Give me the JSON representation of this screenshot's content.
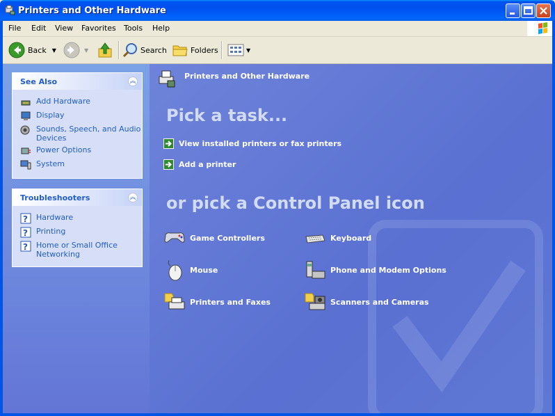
{
  "window": {
    "title": "Printers and Other Hardware"
  },
  "menu": [
    "File",
    "Edit",
    "View",
    "Favorites",
    "Tools",
    "Help"
  ],
  "toolbar": {
    "back_label": "Back",
    "search_label": "Search",
    "folders_label": "Folders"
  },
  "see_also": {
    "title": "See Also",
    "items": [
      {
        "label": "Add Hardware",
        "icon": "add-hardware-icon"
      },
      {
        "label": "Display",
        "icon": "display-icon"
      },
      {
        "label": "Sounds, Speech, and Audio Devices",
        "icon": "sounds-icon"
      },
      {
        "label": "Power Options",
        "icon": "power-icon"
      },
      {
        "label": "System",
        "icon": "system-icon"
      }
    ]
  },
  "troubleshooters": {
    "title": "Troubleshooters",
    "items": [
      {
        "label": "Hardware",
        "icon": "help-icon"
      },
      {
        "label": "Printing",
        "icon": "help-icon"
      },
      {
        "label": "Home or Small Office Networking",
        "icon": "help-icon"
      }
    ]
  },
  "main": {
    "header": "Printers and Other Hardware",
    "pick_task": "Pick a task...",
    "tasks": [
      "View installed printers or fax printers",
      "Add a printer"
    ],
    "pick_icon": "or pick a Control Panel icon",
    "icons": [
      {
        "label": "Game Controllers",
        "icon": "game-controller-icon"
      },
      {
        "label": "Keyboard",
        "icon": "keyboard-icon"
      },
      {
        "label": "Mouse",
        "icon": "mouse-icon"
      },
      {
        "label": "Phone and Modem Options",
        "icon": "phone-modem-icon"
      },
      {
        "label": "Printers and Faxes",
        "icon": "printer-icon"
      },
      {
        "label": "Scanners and Cameras",
        "icon": "scanner-icon"
      }
    ]
  },
  "colors": {
    "title_bar": "#0055e5",
    "task_pane": "#6375d6",
    "main_pane": "#5a70d2",
    "link": "#215dc6"
  }
}
